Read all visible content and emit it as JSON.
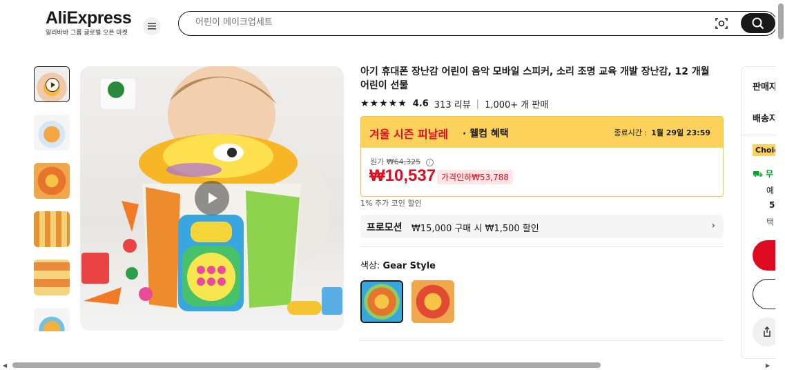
{
  "header": {
    "logo_text": "AliExpress",
    "logo_sub": "알리바바 그룹 글로벌 오픈 마켓",
    "search_placeholder": "어린이 메이크업세트"
  },
  "product": {
    "title": "아기 휴대폰 장난감 어린이 음악 모바일 스피커, 소리 조명 교육 개발 장난감, 12 개월 어린이 선물",
    "rating_value": "4.6",
    "reviews": "313 리뷰",
    "sold": "1,000+ 개 판매",
    "stars": "★★★★★"
  },
  "promo_banner": {
    "title": "겨울 시즌 피날레",
    "subtitle": "· 웰컴 혜택",
    "end_label": "종료시간 :",
    "end_time": "1월 29일 23:59"
  },
  "pricing": {
    "original_label": "원가",
    "original_price": "₩64,325",
    "price": "₩10,537",
    "discount_label": "가격인하₩53,788",
    "coin_text": "1% 추가 코인 할인"
  },
  "promotion": {
    "label": "프로모션",
    "text": "₩15,000 구매 시 ₩1,500 할인"
  },
  "color": {
    "label": "색상:",
    "selected": "Gear Style"
  },
  "side_panel": {
    "seller": "판매자",
    "shipping": "배송지",
    "choice": "Choice",
    "free": "무",
    "t1": "예",
    "t2": "5",
    "t3": "택"
  },
  "colors": {
    "accent_red": "#e10b21",
    "banner_yellow": "#fdd25b"
  }
}
